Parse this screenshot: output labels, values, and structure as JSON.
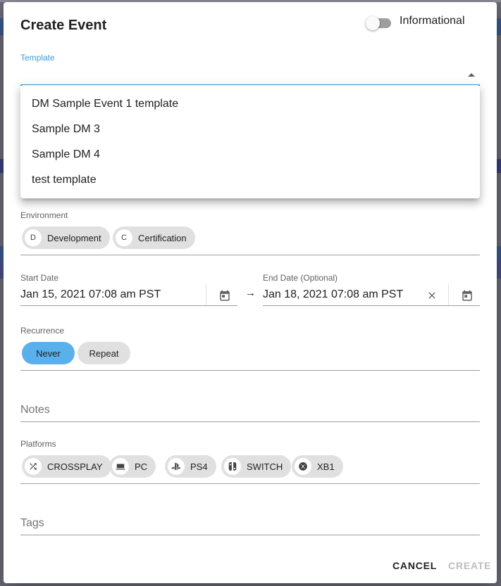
{
  "colors": {
    "accent": "#3d9bd6",
    "chip_selected": "#5ab0ec",
    "chip": "#e0e0e0"
  },
  "dialog": {
    "title": "Create Event",
    "informational_toggle": {
      "label": "Informational",
      "on": false
    }
  },
  "template": {
    "label": "Template",
    "value": "",
    "options": [
      "DM Sample Event 1 template",
      "Sample DM 3",
      "Sample DM 4",
      "test template"
    ]
  },
  "environment": {
    "label": "Environment",
    "chips": [
      {
        "avatar": "D",
        "label": "Development"
      },
      {
        "avatar": "C",
        "label": "Certification"
      }
    ]
  },
  "start_date": {
    "label": "Start Date",
    "value": "Jan 15, 2021 07:08 am PST",
    "icon": "calendar-icon"
  },
  "end_date": {
    "label": "End Date (Optional)",
    "value": "Jan 18, 2021 07:08 am PST",
    "icon": "calendar-icon"
  },
  "arrow": "→",
  "recurrence": {
    "label": "Recurrence",
    "options": [
      "Never",
      "Repeat"
    ],
    "selected": "Never"
  },
  "notes": {
    "placeholder": "Notes"
  },
  "platforms": {
    "label": "Platforms",
    "chips": [
      {
        "icon": "shuffle-icon",
        "label": "CROSSPLAY"
      },
      {
        "icon": "pc-icon",
        "label": "PC"
      },
      {
        "icon": "playstation-icon",
        "label": "PS4"
      },
      {
        "icon": "switch-icon",
        "label": "SWITCH"
      },
      {
        "icon": "xbox-icon",
        "label": "XB1"
      }
    ]
  },
  "tags": {
    "placeholder": "Tags"
  },
  "actions": {
    "cancel": "CANCEL",
    "create": "CREATE"
  }
}
